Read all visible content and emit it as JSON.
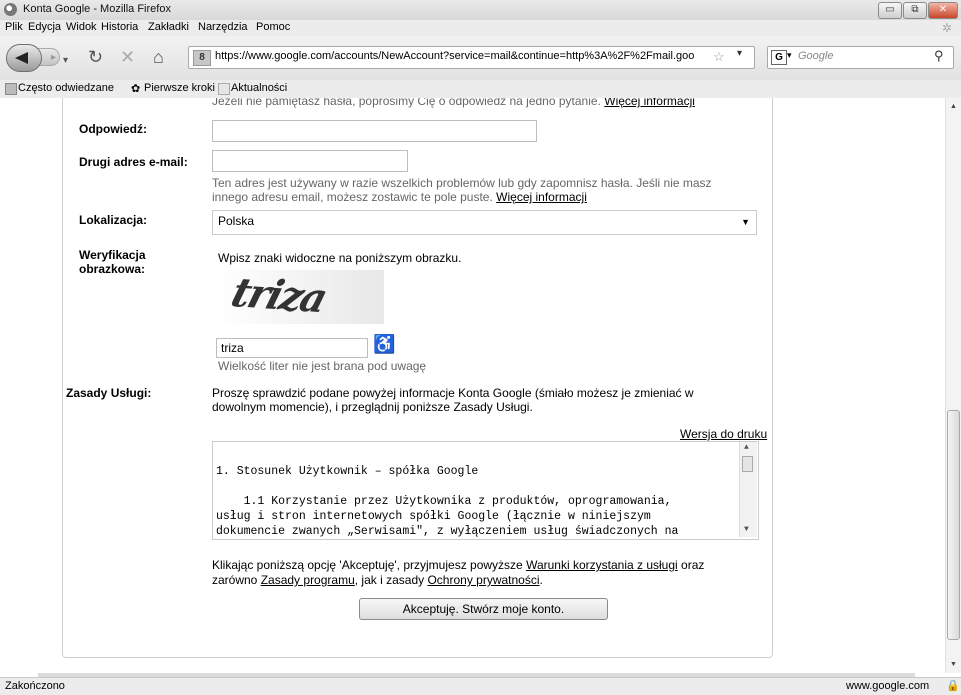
{
  "window": {
    "title": "Konta Google - Mozilla Firefox"
  },
  "menu": [
    "Plik",
    "Edycja",
    "Widok",
    "Historia",
    "Zakładki",
    "Narzędzia",
    "Pomoc"
  ],
  "nav": {
    "url": "https://www.google.com/accounts/NewAccount?service=mail&continue=http%3A%2F%2Fmail.goo",
    "search_placeholder": "Google",
    "site_badge": "8"
  },
  "bookmarks": [
    "Często odwiedzane",
    "Pierwsze kroki",
    "Aktualności"
  ],
  "form": {
    "question_hint": "Jeżeli nie pamiętasz hasła, poprosimy Cię o odpowiedź na jedno pytanie.",
    "question_more": "Więcej informacji",
    "answer_label": "Odpowiedź:",
    "answer_value": "",
    "email2_label": "Drugi adres e-mail:",
    "email2_value": "",
    "email2_hint_1": "Ten adres jest używany w razie wszelkich problemów lub gdy zapomnisz hasła. Jeśli nie masz",
    "email2_hint_2": "innego adresu email, możesz zostawic te pole puste.",
    "email2_more": "Więcej informacji",
    "location_label": "Lokalizacja:",
    "location_value": "Polska",
    "captcha_label_1": "Weryfikacja",
    "captcha_label_2": "obrazkowa:",
    "captcha_instruction": "Wpisz znaki widoczne na poniższym obrazku.",
    "captcha_image_text": "triza",
    "captcha_value": "triza",
    "captcha_hint": "Wielkość liter nie jest brana pod uwagę",
    "tos_label": "Zasady Usługi:",
    "tos_intro_1": "Proszę sprawdzić podane powyżej informacje Konta Google (śmiało możesz je zmieniać w",
    "tos_intro_2": "dowolnym momencie), i przeglądnij poniższe Zasady Usługi.",
    "print_link": "Wersja do druku",
    "tos_text": "1. Stosunek Użytkownik – spółka Google\n\n    1.1 Korzystanie przez Użytkownika z produktów, oprogramowania,\nusług i stron internetowych spółki Google (łącznie w niniejszym\ndokumencie zwanych „Serwisami\", z wyłączeniem usług świadczonych na",
    "accept_pre": "Klikając poniższą opcję 'Akceptuję', przyjmujesz powyższe",
    "accept_link1": "Warunki korzystania z usługi",
    "accept_mid": "oraz",
    "accept_pre2": "zarówno",
    "accept_link2": "Zasady programu",
    "accept_mid2": ", jak i zasady",
    "accept_link3": "Ochrony prywatności",
    "accept_end": ".",
    "accept_button": "Akceptuję. Stwórz moje konto."
  },
  "status": {
    "left": "Zakończono",
    "right": "www.google.com"
  }
}
